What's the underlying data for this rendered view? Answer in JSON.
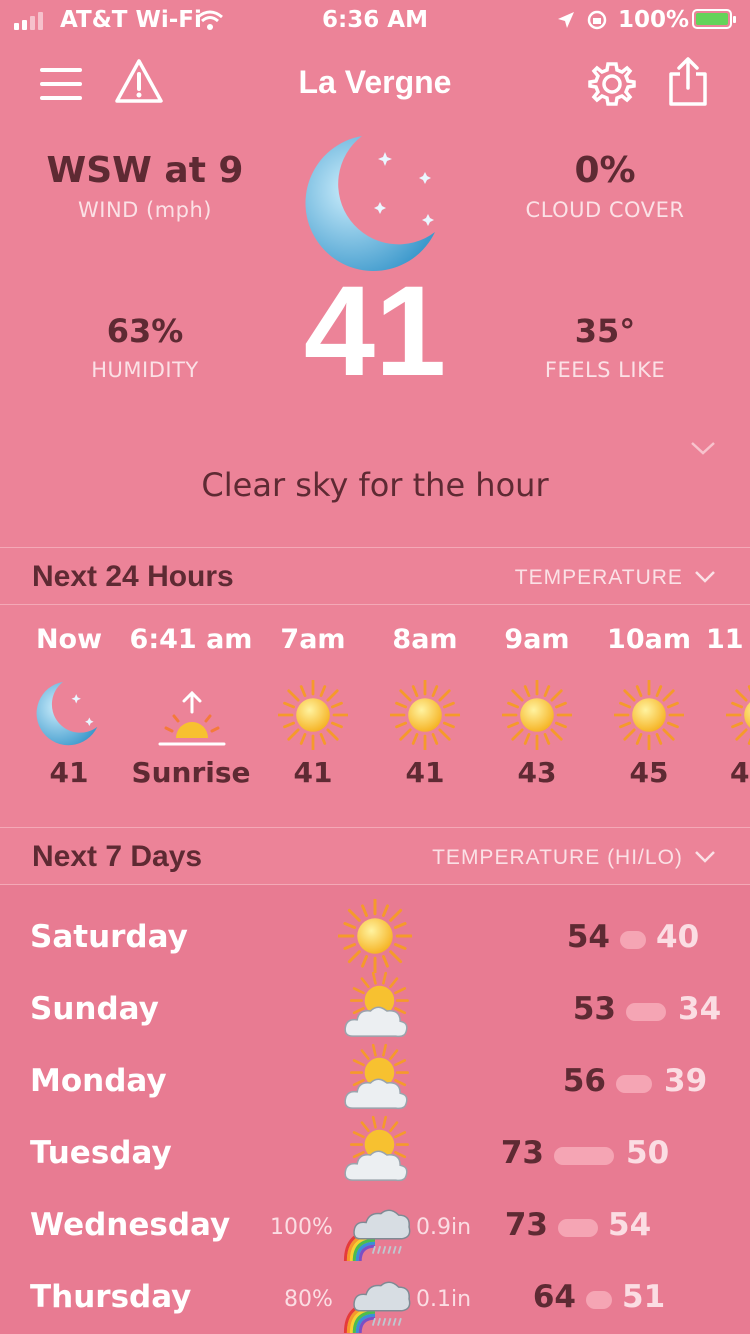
{
  "status_bar": {
    "carrier": "AT&T Wi-Fi",
    "time": "6:36 AM",
    "battery": "100%"
  },
  "header": {
    "title": "La Vergne"
  },
  "current": {
    "wind_value": "WSW at 9",
    "wind_label": "WIND (mph)",
    "cloud_value": "0%",
    "cloud_label": "CLOUD COVER",
    "humidity_value": "63%",
    "humidity_label": "HUMIDITY",
    "feels_value": "35°",
    "feels_label": "FEELS LIKE",
    "temperature": "41",
    "summary": "Clear sky for the hour"
  },
  "hourly": {
    "title": "Next 24 Hours",
    "selector": "TEMPERATURE",
    "items": [
      {
        "time": "Now",
        "icon": "moon-icon",
        "value": "41"
      },
      {
        "time": "6:41 am",
        "icon": "sunrise-icon",
        "value": "Sunrise"
      },
      {
        "time": "7am",
        "icon": "sun-icon",
        "value": "41"
      },
      {
        "time": "8am",
        "icon": "sun-icon",
        "value": "41"
      },
      {
        "time": "9am",
        "icon": "sun-icon",
        "value": "43"
      },
      {
        "time": "10am",
        "icon": "sun-icon",
        "value": "45"
      },
      {
        "time": "11",
        "icon": "sun-icon",
        "value": "4"
      }
    ]
  },
  "daily": {
    "title": "Next 7 Days",
    "selector": "TEMPERATURE (HI/LO)",
    "items": [
      {
        "day": "Saturday",
        "icon": "sun-icon",
        "precip_chance": "",
        "precip_amount": "",
        "hi": "54",
        "lo": "40"
      },
      {
        "day": "Sunday",
        "icon": "partly-cloudy-icon",
        "precip_chance": "",
        "precip_amount": "",
        "hi": "53",
        "lo": "34"
      },
      {
        "day": "Monday",
        "icon": "partly-cloudy-icon",
        "precip_chance": "",
        "precip_amount": "",
        "hi": "56",
        "lo": "39"
      },
      {
        "day": "Tuesday",
        "icon": "partly-cloudy-icon",
        "precip_chance": "",
        "precip_amount": "",
        "hi": "73",
        "lo": "50"
      },
      {
        "day": "Wednesday",
        "icon": "rain-rainbow-icon",
        "precip_chance": "100%",
        "precip_amount": "0.9in",
        "hi": "73",
        "lo": "54"
      },
      {
        "day": "Thursday",
        "icon": "rain-rainbow-icon",
        "precip_chance": "80%",
        "precip_amount": "0.1in",
        "hi": "64",
        "lo": "51"
      }
    ]
  },
  "colors": {
    "background": "#ec8398",
    "text_dark": "#5e2a33",
    "text_light": "#fbe1e6",
    "moon": "#5fb4e0",
    "sun": "#f7c130"
  }
}
